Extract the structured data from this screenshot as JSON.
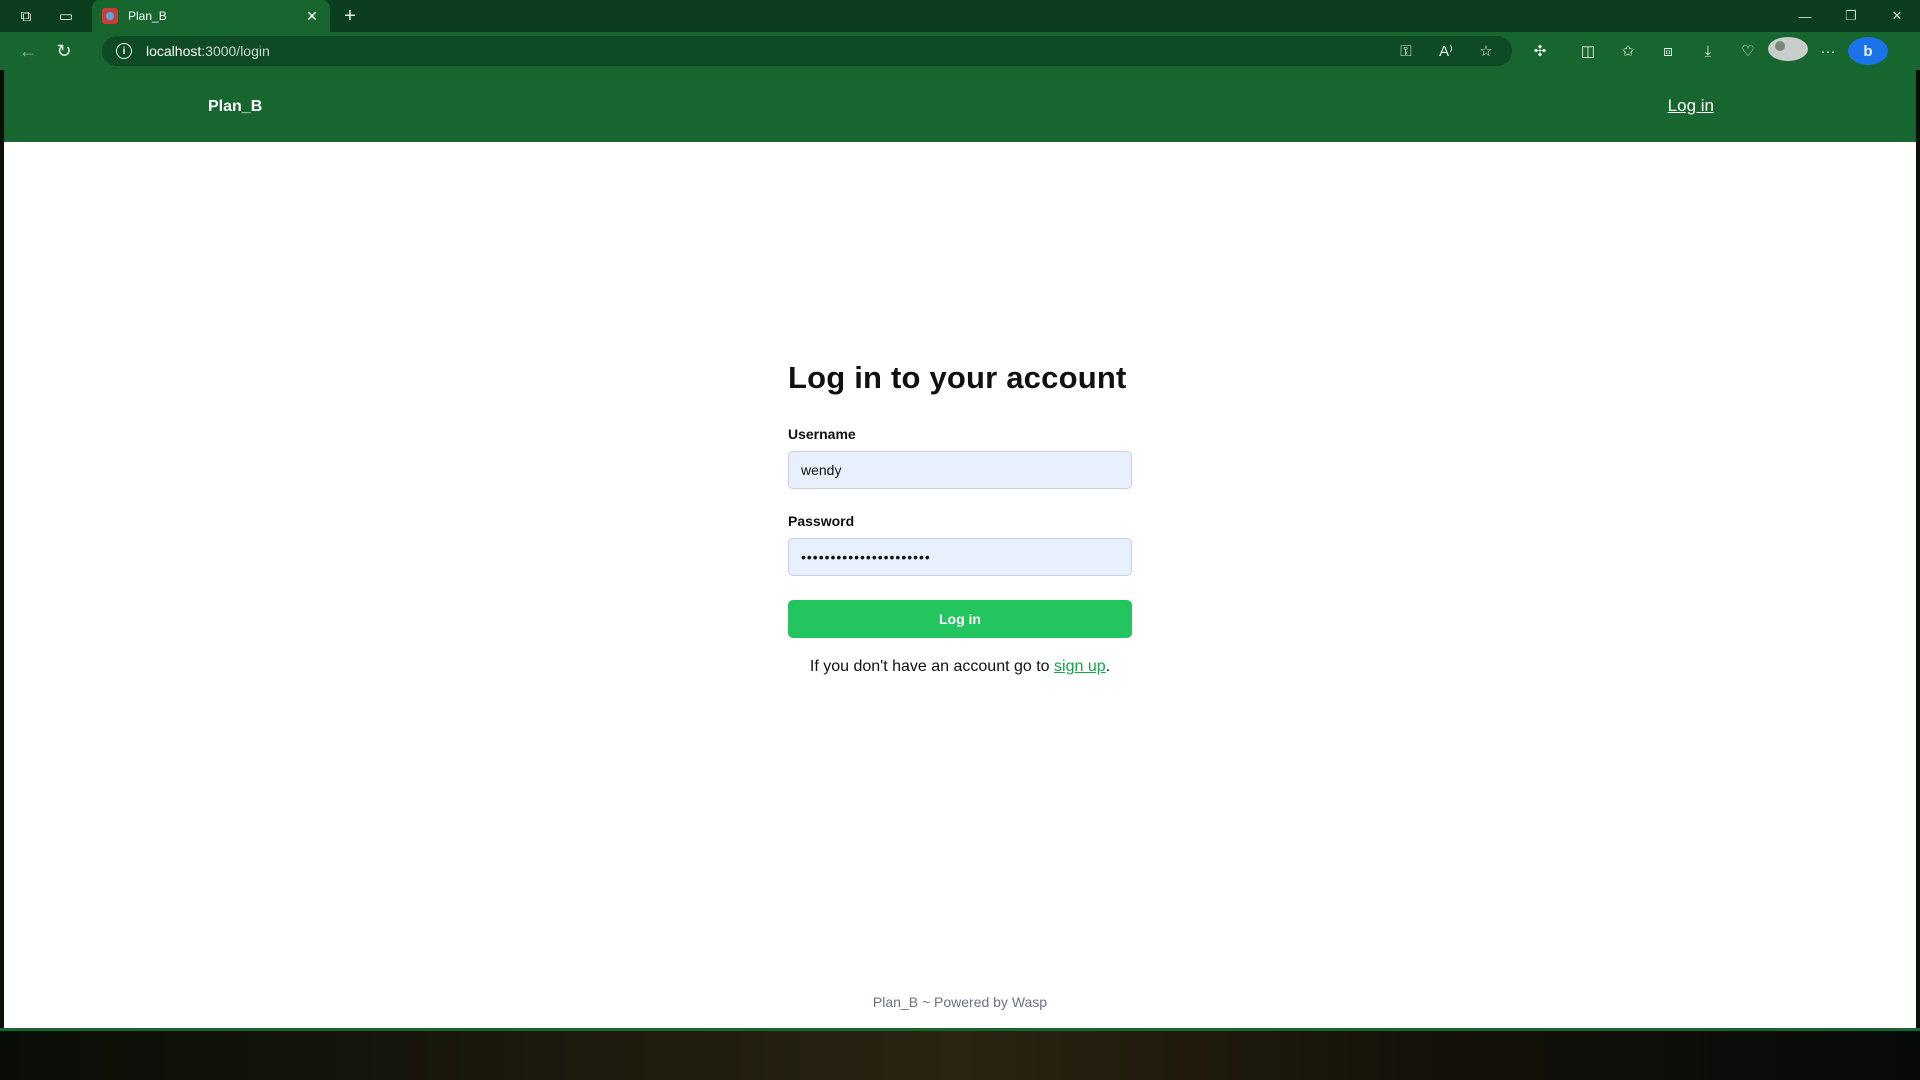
{
  "browser": {
    "tab_title": "Plan_B",
    "tab_close": "✕",
    "new_tab": "+",
    "url_host": "localhost",
    "url_path": ":3000/login",
    "window_controls": {
      "minimize": "—",
      "restore": "❐",
      "close": "✕"
    }
  },
  "header": {
    "brand": "Plan_B",
    "login_link": "Log in"
  },
  "login": {
    "title": "Log in to your account",
    "username_label": "Username",
    "username_value": "wendy",
    "password_label": "Password",
    "password_value": "••••••••••••••••••••••",
    "submit_label": "Log in",
    "signup_prefix": "If you don't have an account go to ",
    "signup_link": "sign up",
    "signup_suffix": "."
  },
  "footer": {
    "text": "Plan_B ~ Powered by Wasp"
  },
  "colors": {
    "header_green": "#17652f",
    "button_green": "#22c55e",
    "link_green": "#16a34a",
    "input_bg": "#e8f0fe"
  },
  "icons": [
    "workspaces-icon",
    "tab-actions-icon",
    "back-icon",
    "refresh-icon",
    "info-icon",
    "key-icon",
    "read-aloud-icon",
    "favorite-icon",
    "extensions-icon",
    "split-screen-icon",
    "favorites-icon",
    "collections-icon",
    "downloads-icon",
    "health-icon",
    "profile-icon",
    "more-icon",
    "copilot-icon"
  ]
}
